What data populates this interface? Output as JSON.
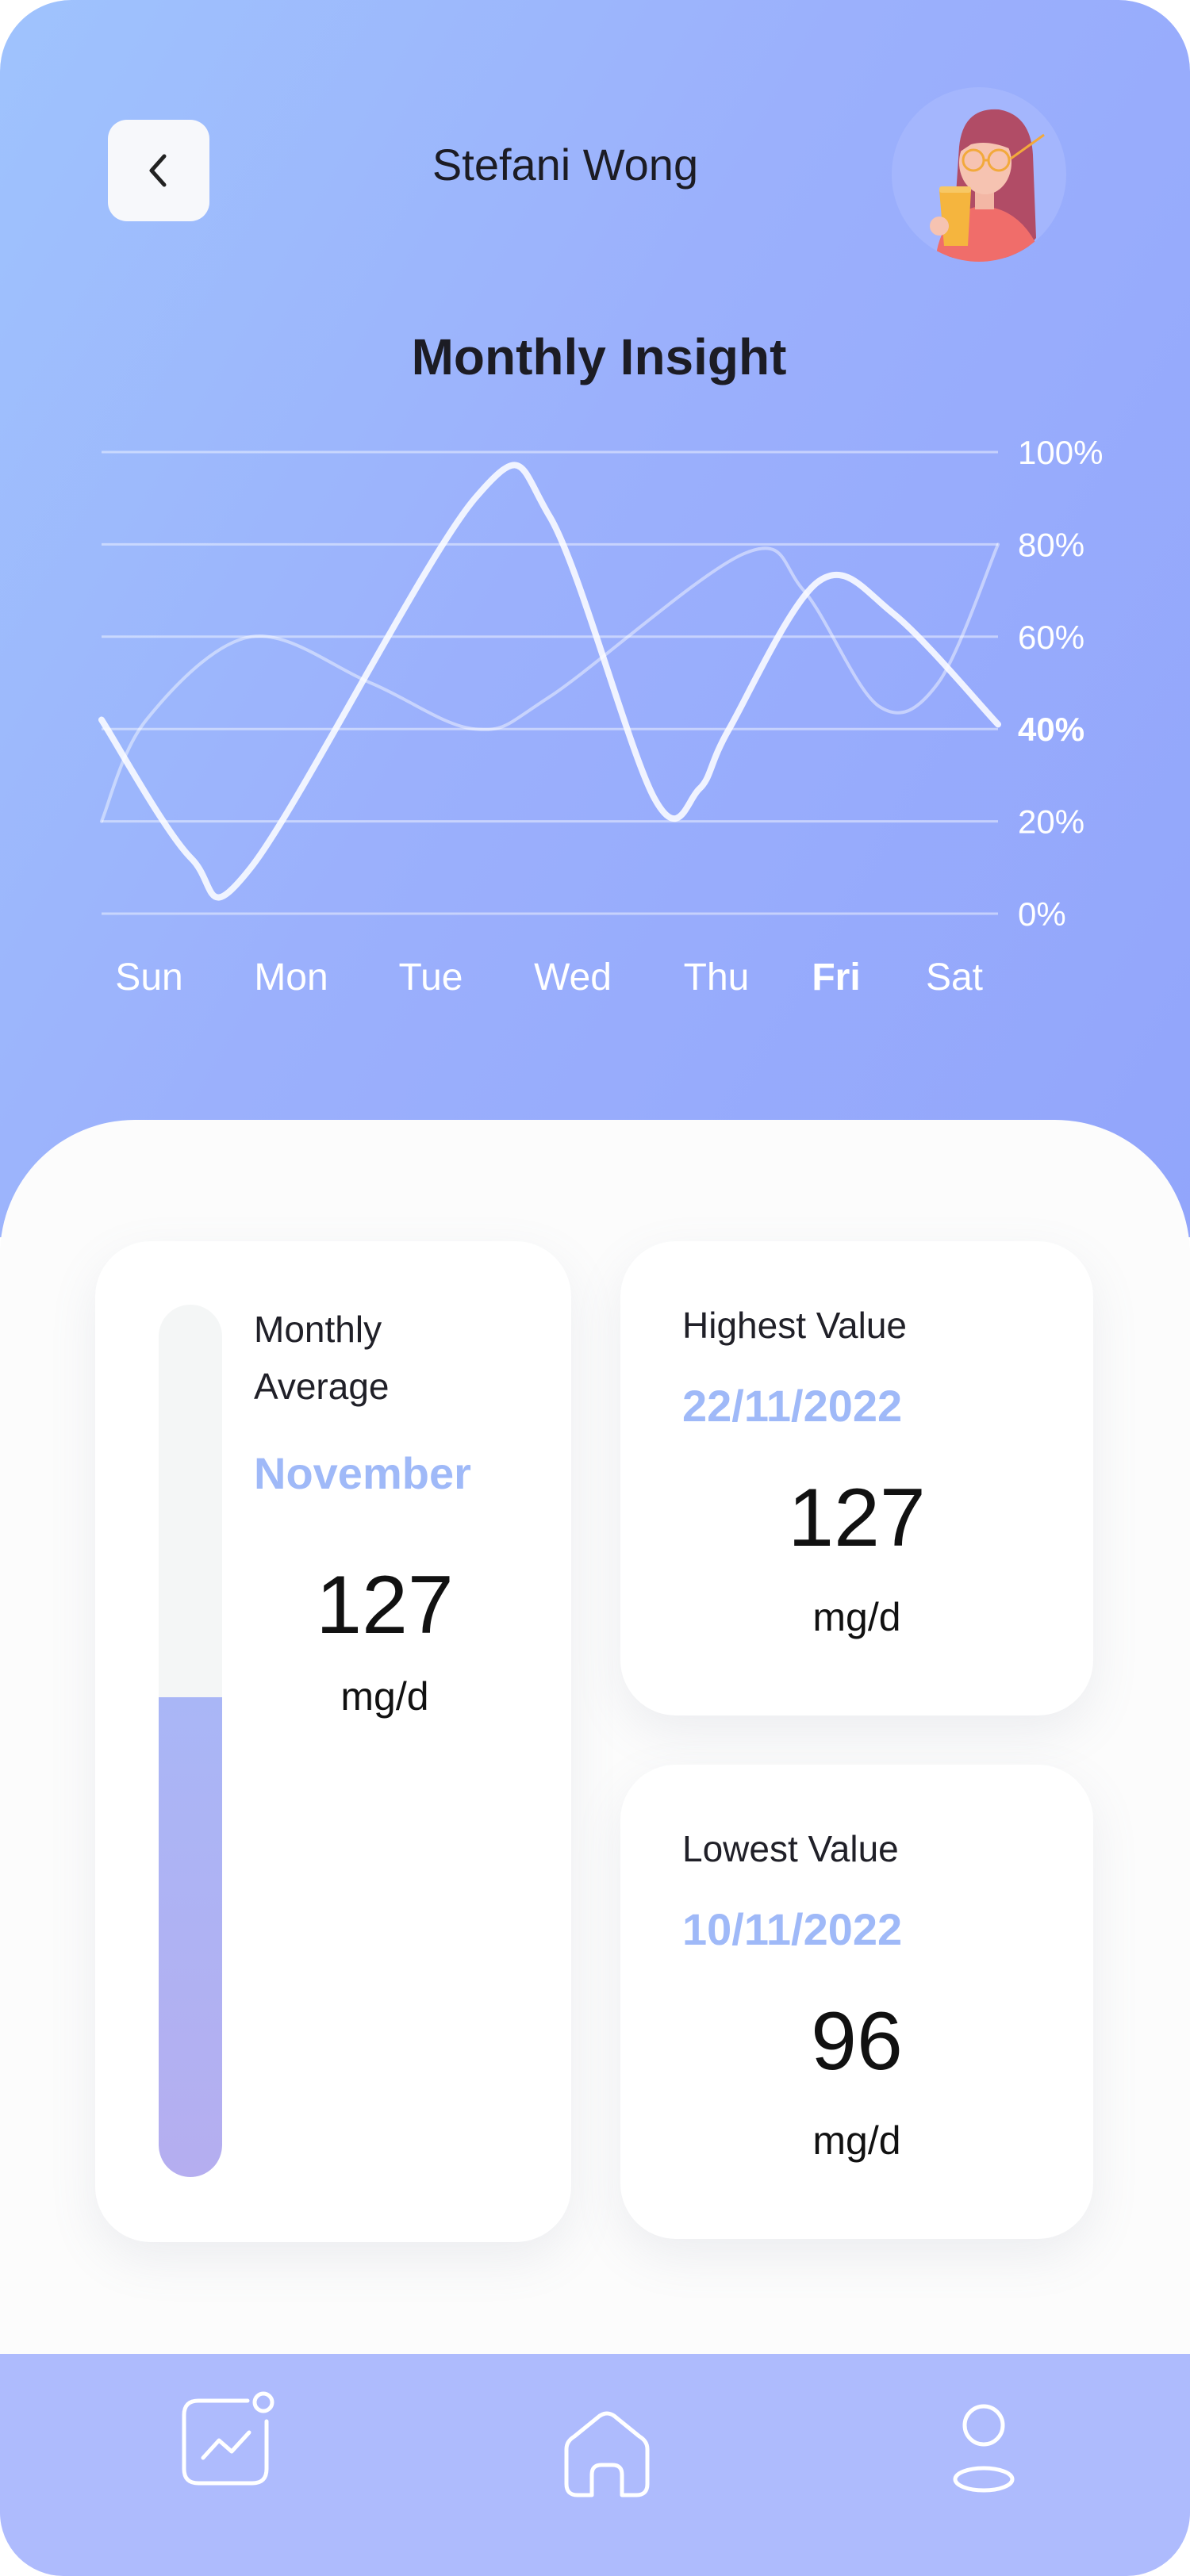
{
  "header": {
    "user_name": "Stefani Wong",
    "title": "Monthly Insight"
  },
  "chart_data": {
    "type": "line",
    "title": "Monthly Insight",
    "categories": [
      "Sun",
      "Mon",
      "Tue",
      "Wed",
      "Thu",
      "Fri",
      "Sat"
    ],
    "highlighted_category": "Fri",
    "highlighted_value_label": "40%",
    "y_ticks": [
      "100%",
      "80%",
      "60%",
      "40%",
      "20%",
      "0%"
    ],
    "ylim": [
      0,
      100
    ],
    "grid": true,
    "series": [
      {
        "x": [
          0,
          0.6,
          1.0,
          2.5,
          3.0,
          3.7,
          4.0,
          4.2,
          4.8,
          5.3,
          6.0
        ],
        "values": [
          42,
          12,
          10,
          90,
          86,
          25,
          27,
          40,
          72,
          65,
          41
        ]
      },
      {
        "x": [
          0,
          0.3,
          1.0,
          1.8,
          2.5,
          3.0,
          4.3,
          4.7,
          5.2,
          5.6,
          6.0
        ],
        "values": [
          20,
          42,
          60,
          50,
          40,
          47,
          78,
          70,
          45,
          50,
          80
        ]
      }
    ]
  },
  "stats": {
    "average": {
      "title_line1": "Monthly",
      "title_line2": "Average",
      "subtitle": "November",
      "value": "127",
      "unit": "mg/d",
      "fill_fraction": 0.55
    },
    "highest": {
      "title": "Highest Value",
      "date": "22/11/2022",
      "value": "127",
      "unit": "mg/d"
    },
    "lowest": {
      "title": "Lowest Value",
      "date": "10/11/2022",
      "value": "96",
      "unit": "mg/d"
    }
  },
  "nav": {
    "items": [
      {
        "icon": "activity-chart-icon"
      },
      {
        "icon": "home-icon"
      },
      {
        "icon": "profile-icon"
      }
    ]
  },
  "colors": {
    "accent": "#9fb9f8",
    "nav_background": "#aebbfd",
    "header_gradient_start": "#9fc3fd",
    "header_gradient_end": "#92a5fb"
  }
}
